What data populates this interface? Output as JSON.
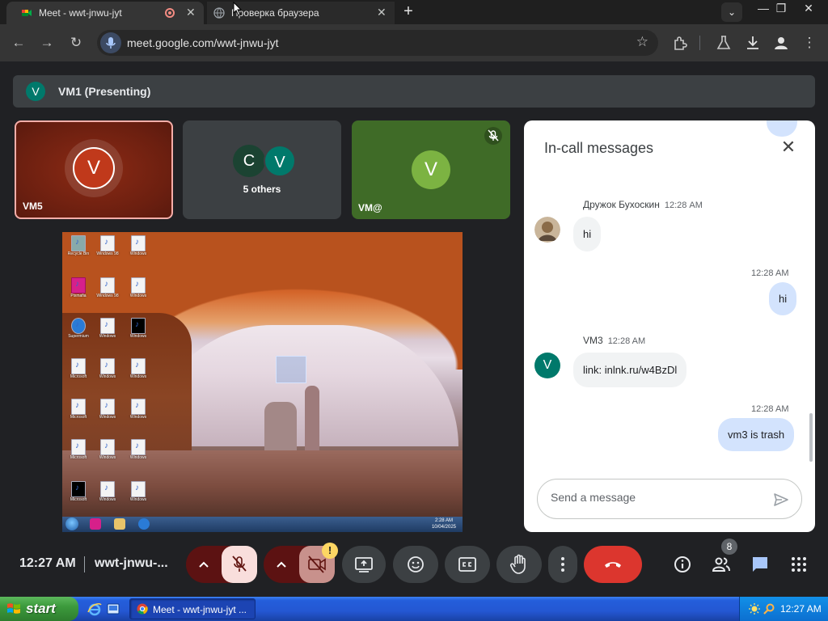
{
  "browser": {
    "tabs": [
      {
        "title": "Meet - wwt-jnwu-jyt",
        "active": true
      },
      {
        "title": "Проверка браузера",
        "active": false
      }
    ],
    "address": "meet.google.com/wwt-jnwu-jyt"
  },
  "meet": {
    "presenting_label": "VM1 (Presenting)",
    "presenting_initial": "V",
    "tiles": [
      {
        "name": "VM5",
        "initial": "V"
      },
      {
        "others_label": "5 others",
        "initials": [
          "C",
          "V"
        ]
      },
      {
        "name": "VM@",
        "initial": "V"
      }
    ]
  },
  "chat": {
    "title": "In-call messages",
    "messages": [
      {
        "sender": "Дружок Бухоскин",
        "time": "12:28 AM",
        "text": "hi",
        "direction": "in"
      },
      {
        "time": "12:28 AM",
        "text": "hi",
        "direction": "out"
      },
      {
        "sender": "VM3",
        "time": "12:28 AM",
        "text": "link: inlnk.ru/w4BzDl",
        "direction": "in",
        "initial": "V"
      },
      {
        "time": "12:28 AM",
        "text": "vm3 is trash",
        "direction": "out"
      }
    ],
    "input_placeholder": "Send a message"
  },
  "controls": {
    "clock": "12:27 AM",
    "meeting_code": "wwt-jnwu-...",
    "warning_badge": "!",
    "people_count": "8"
  },
  "shared_screen": {
    "taskbar_time": "2:28 AM",
    "taskbar_date": "10/04/2025"
  },
  "xp_taskbar": {
    "start_label": "start",
    "task_label": "Meet - wwt-jnwu-jyt ...",
    "clock": "12:27 AM"
  },
  "colors": {
    "leave_red": "#dc362e",
    "mute_bg": "#f9dedc",
    "chat_out_bubble": "#d3e3fd",
    "tile_vm5": "#6b1f10",
    "tile_vmat": "#3f6b27"
  }
}
